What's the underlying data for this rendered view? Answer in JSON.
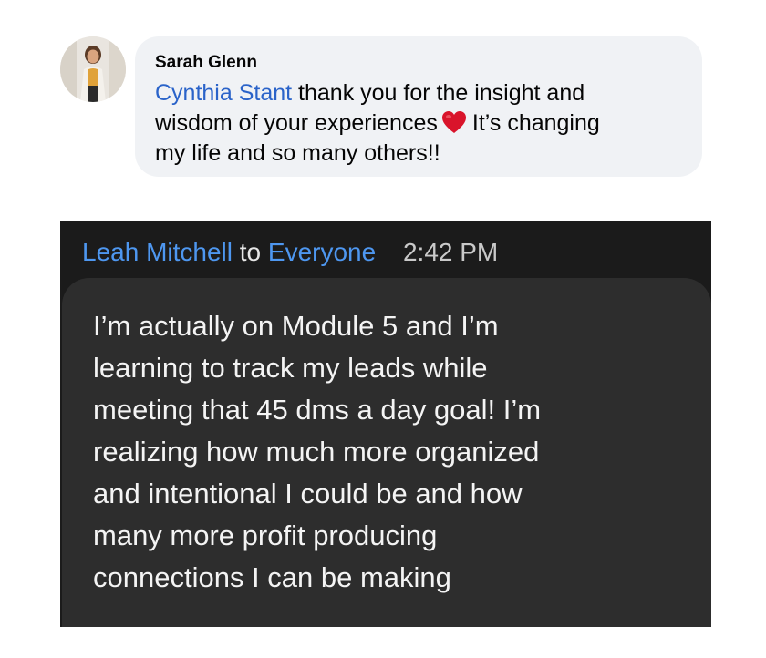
{
  "facebook_comment": {
    "author": "Sarah Glenn",
    "mention": "Cynthia Stant",
    "text_line_1_after_mention": " thank you for the insight and",
    "text_line_2_before_heart": "wisdom of your experiences",
    "heart_icon": "red-heart-emoji",
    "text_line_2_after_heart": "It’s changing",
    "text_line_3": "my life and so many others!!",
    "bubble_color": "#f0f2f5",
    "mention_color": "#2a63c9"
  },
  "zoom_message": {
    "sender": "Leah Mitchell",
    "connector": "to",
    "recipient": "Everyone",
    "time": "2:42 PM",
    "lines": [
      "I’m actually on Module 5 and I’m",
      "learning to track my leads while",
      "meeting that 45 dms a day goal! I’m",
      "realizing how much more organized",
      "and intentional I could be and how",
      "many more profit producing",
      "connections I can be making"
    ],
    "panel_color": "#1b1b1b",
    "bubble_color": "#2d2d2d",
    "name_color": "#4e97f0"
  }
}
